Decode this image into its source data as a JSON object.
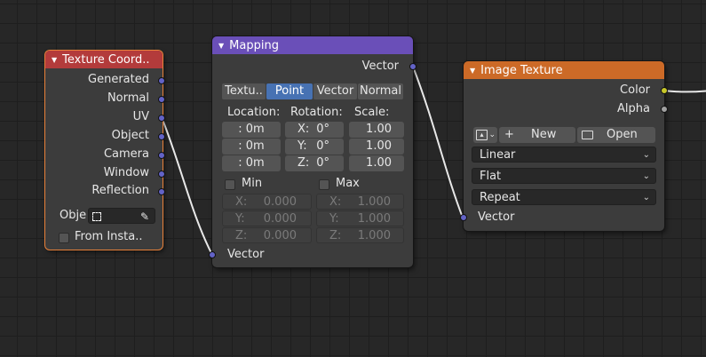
{
  "colors": {
    "texture_coord_header": "#b33b3b",
    "mapping_header": "#6a4fb8",
    "image_texture_header": "#cc6a27",
    "vector_socket": "#6363c7",
    "color_socket": "#c7c729",
    "float_socket": "#a1a1a1",
    "active_tab": "#4772b3",
    "selection_outline": "#e8813a"
  },
  "texture_coord": {
    "title": "Texture Coord..",
    "outputs": [
      "Generated",
      "Normal",
      "UV",
      "Object",
      "Camera",
      "Window",
      "Reflection"
    ],
    "object_label": "Obje",
    "from_instancer": "From Insta.."
  },
  "mapping": {
    "title": "Mapping",
    "output": "Vector",
    "tabs": [
      "Textu..",
      "Point",
      "Vector",
      "Normal"
    ],
    "active_tab": "Point",
    "location_label": "Location:",
    "rotation_label": "Rotation:",
    "scale_label": "Scale:",
    "location": [
      ":  0m",
      ":  0m",
      ":  0m"
    ],
    "rotation": [
      {
        "axis": "X:",
        "value": "0°"
      },
      {
        "axis": "Y:",
        "value": "0°"
      },
      {
        "axis": "Z:",
        "value": "0°"
      }
    ],
    "scale": [
      "1.00",
      "1.00",
      "1.00"
    ],
    "min_label": "Min",
    "max_label": "Max",
    "min": [
      {
        "axis": "X:",
        "value": "0.000"
      },
      {
        "axis": "Y:",
        "value": "0.000"
      },
      {
        "axis": "Z:",
        "value": "0.000"
      }
    ],
    "max": [
      {
        "axis": "X:",
        "value": "1.000"
      },
      {
        "axis": "Y:",
        "value": "1.000"
      },
      {
        "axis": "Z:",
        "value": "1.000"
      }
    ],
    "input": "Vector"
  },
  "image_texture": {
    "title": "Image Texture",
    "outputs": [
      "Color",
      "Alpha"
    ],
    "new_label": "New",
    "open_label": "Open",
    "interpolation": "Linear",
    "projection": "Flat",
    "extension": "Repeat",
    "input": "Vector"
  },
  "icons": {
    "collapse": "triangle-down-icon",
    "image_browse": "image-icon",
    "add": "plus-icon",
    "open": "folder-icon",
    "object": "object-icon",
    "eyedropper": "eyedropper-icon"
  }
}
